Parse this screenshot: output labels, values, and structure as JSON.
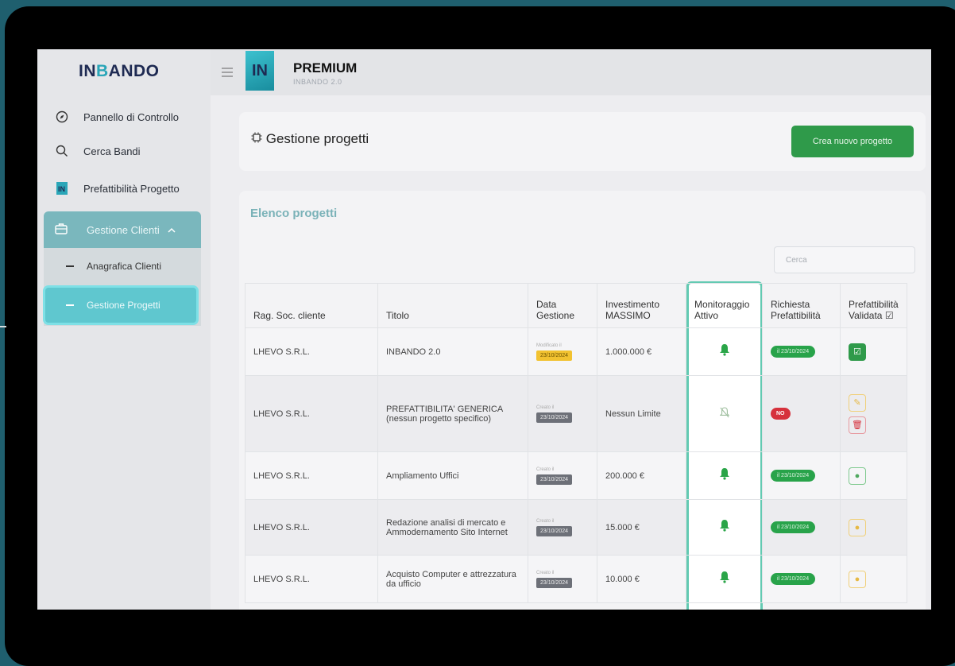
{
  "brand": {
    "logo_text_a": "IN",
    "logo_text_b": "BANDO",
    "badge": "IN"
  },
  "plan": {
    "title": "PREMIUM",
    "subtitle": "INBANDO 2.0"
  },
  "sidebar": {
    "items": [
      {
        "label": "Pannello di Controllo",
        "icon": "compass-icon"
      },
      {
        "label": "Cerca Bandi",
        "icon": "search-icon"
      },
      {
        "label": "Prefattibilità Progetto",
        "icon": "in-logo-icon"
      }
    ],
    "group": {
      "label": "Gestione Clienti",
      "icon": "briefcase-icon"
    },
    "subitems": [
      {
        "label": "Anagrafica Clienti"
      },
      {
        "label": "Gestione Progetti",
        "active": true
      }
    ]
  },
  "header": {
    "title": "Gestione progetti",
    "create_button": "Crea nuovo progetto"
  },
  "list": {
    "title": "Elenco progetti",
    "search_placeholder": "Cerca",
    "columns": [
      "Rag. Soc. cliente",
      "Titolo",
      "Data Gestione",
      "Investimento MASSIMO",
      "Monitoraggio Attivo",
      "Richiesta Prefattibilità",
      "Prefattibilità Validata"
    ],
    "rows": [
      {
        "client": "LHEVO S.R.L.",
        "title": "INBANDO 2.0",
        "date_caption": "Modificato il",
        "date": "23/10/2024",
        "date_color": "yellow",
        "investment": "1.000.000 €",
        "monitoring": "on",
        "request": "il 23/10/2024",
        "validated": "check"
      },
      {
        "client": "LHEVO S.R.L.",
        "title": "PREFATTIBILITA' GENERICA (nessun progetto specifico)",
        "date_caption": "Creato il",
        "date": "23/10/2024",
        "date_color": "gray",
        "investment": "Nessun Limite",
        "monitoring": "off",
        "request": "NO",
        "validated": "edit-delete"
      },
      {
        "client": "LHEVO S.R.L.",
        "title": "Ampliamento Uffici",
        "date_caption": "Creato il",
        "date": "23/10/2024",
        "date_color": "gray",
        "investment": "200.000 €",
        "monitoring": "on",
        "request": "il 23/10/2024",
        "validated": "view-green"
      },
      {
        "client": "LHEVO S.R.L.",
        "title": "Redazione analisi di mercato e Ammodernamento Sito Internet",
        "date_caption": "Creato il",
        "date": "23/10/2024",
        "date_color": "gray",
        "investment": "15.000 €",
        "monitoring": "on",
        "request": "il 23/10/2024",
        "validated": "view-yellow"
      },
      {
        "client": "LHEVO S.R.L.",
        "title": "Acquisto Computer e attrezzatura da ufficio",
        "date_caption": "Creato il",
        "date": "23/10/2024",
        "date_color": "gray",
        "investment": "10.000 €",
        "monitoring": "on",
        "request": "il 23/10/2024",
        "validated": "view-yellow"
      }
    ]
  }
}
